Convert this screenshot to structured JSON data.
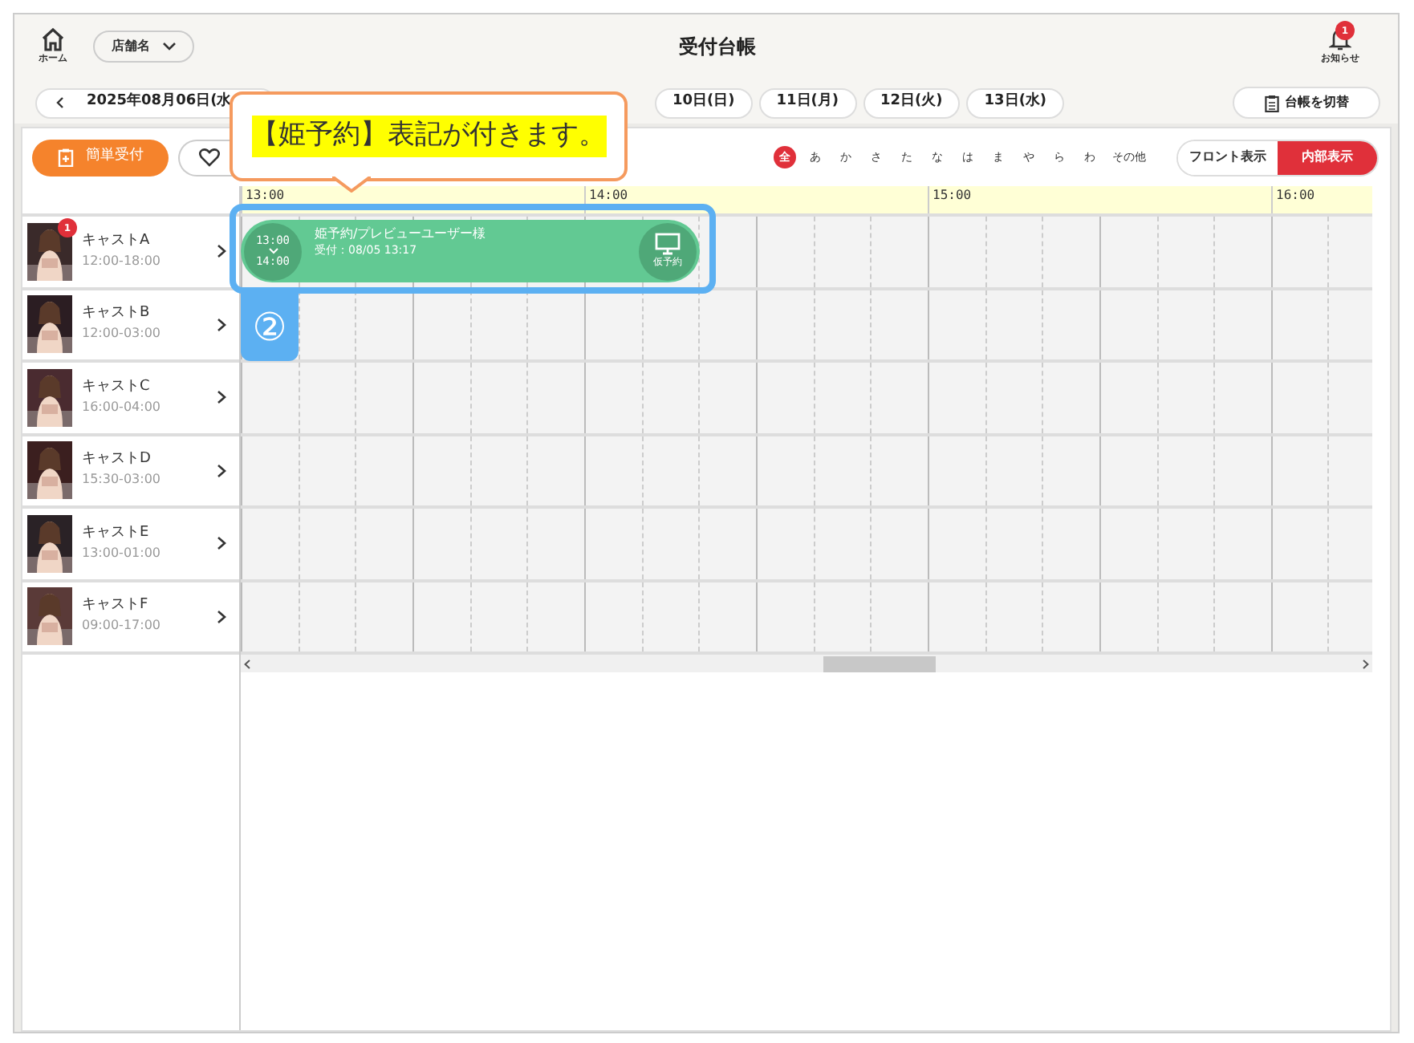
{
  "header": {
    "home_label": "ホーム",
    "store_select": "店舗名",
    "title": "受付台帳",
    "notifications": {
      "label": "お知らせ",
      "badge": "1"
    }
  },
  "date_nav": {
    "current": "2025年08月06日(水",
    "days": [
      "10日(日)",
      "11日(月)",
      "12日(火)",
      "13日(水)"
    ],
    "switch_button": "台帳を切替"
  },
  "toolbar": {
    "quick_button": "簡単受付",
    "kana_filters": [
      {
        "label": "全",
        "selected": true
      },
      {
        "label": "あ",
        "selected": false
      },
      {
        "label": "か",
        "selected": false
      },
      {
        "label": "さ",
        "selected": false
      },
      {
        "label": "た",
        "selected": false
      },
      {
        "label": "な",
        "selected": false
      },
      {
        "label": "は",
        "selected": false
      },
      {
        "label": "ま",
        "selected": false
      },
      {
        "label": "や",
        "selected": false
      },
      {
        "label": "ら",
        "selected": false
      },
      {
        "label": "わ",
        "selected": false
      },
      {
        "label": "その他",
        "selected": false
      }
    ],
    "view_toggle": [
      {
        "label": "フロント表示",
        "selected": false
      },
      {
        "label": "内部表示",
        "selected": true
      }
    ]
  },
  "timeline": {
    "hours": [
      "13:00",
      "14:00",
      "15:00",
      "16:00"
    ],
    "casts": [
      {
        "name": "キャストA",
        "hours": "12:00-18:00",
        "badge": "1",
        "reservation": {
          "start": "13:00",
          "end": "14:00",
          "title": "姫予約/プレビューユーザー様",
          "received": "受付：08/05 13:17",
          "status": "仮予約"
        }
      },
      {
        "name": "キャストB",
        "hours": "12:00-03:00"
      },
      {
        "name": "キャストC",
        "hours": "16:00-04:00"
      },
      {
        "name": "キャストD",
        "hours": "15:30-03:00"
      },
      {
        "name": "キャストE",
        "hours": "13:00-01:00"
      },
      {
        "name": "キャストF",
        "hours": "09:00-17:00"
      }
    ]
  },
  "annotation": {
    "callout": "【姫予約】表記が付きます。",
    "step": "②"
  }
}
